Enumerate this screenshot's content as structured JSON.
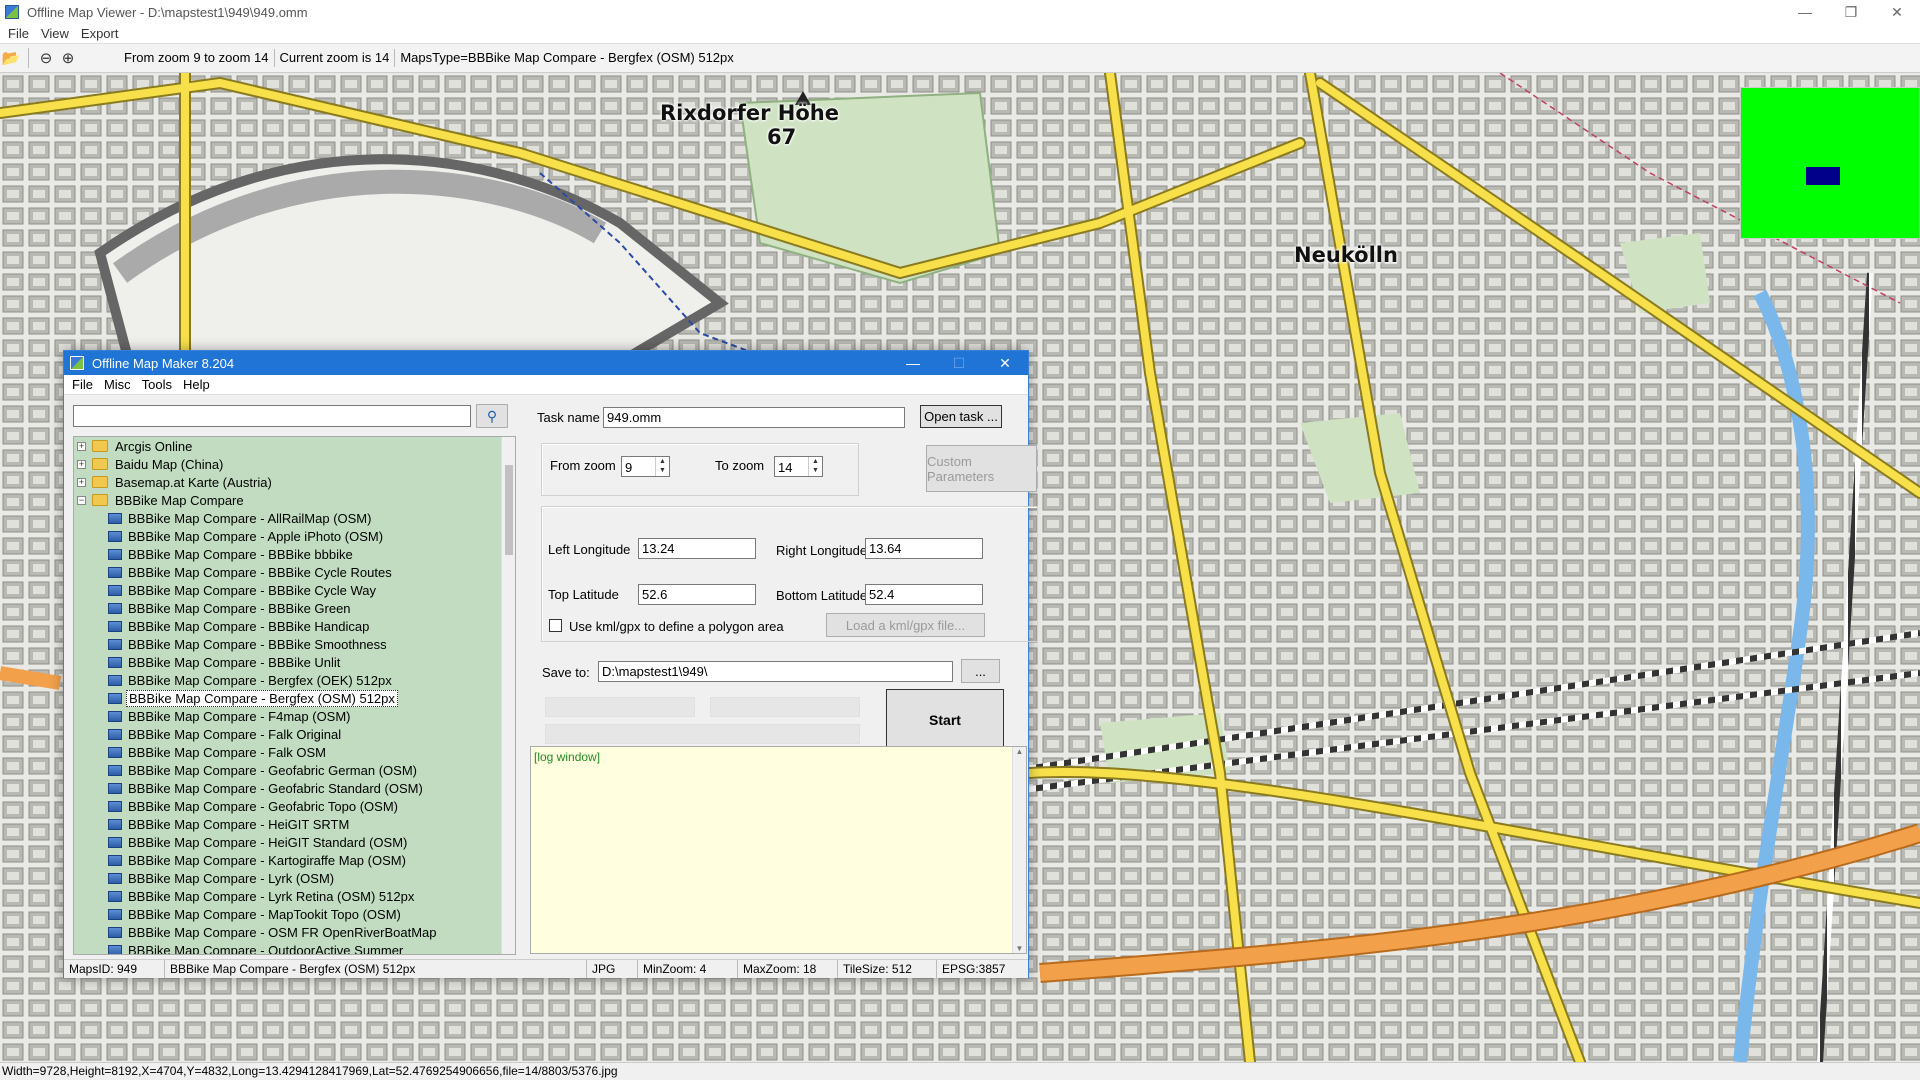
{
  "viewer": {
    "title": "Offline Map Viewer - D:\\mapstest1\\949\\949.omm",
    "menu": [
      "File",
      "View",
      "Export"
    ],
    "toolbar": {
      "zoom_range": "From zoom 9 to zoom 14",
      "current_zoom": "Current zoom is 14",
      "maps_type": "MapsType=BBBike Map Compare - Bergfex (OSM) 512px"
    },
    "map_labels": {
      "rixdorfer_hoehe": "Rixdorfer Höhe",
      "elevation": "67",
      "neukoelln": "Neukölln"
    },
    "status": "Width=9728,Height=8192,X=4704,Y=4832,Long=13.4294128417969,Lat=52.4769254906656,file=14/8803/5376.jpg"
  },
  "dialog": {
    "title": "Offline Map Maker 8.204",
    "menu": [
      "File",
      "Misc",
      "Tools",
      "Help"
    ],
    "search": {
      "value": "",
      "placeholder": ""
    },
    "tree": {
      "top_folders": [
        "Arcgis Online",
        "Baidu Map (China)",
        "Basemap.at Karte (Austria)",
        "BBBike Map Compare"
      ],
      "children": [
        "BBBike Map Compare - AllRailMap (OSM)",
        "BBBike Map Compare - Apple iPhoto (OSM)",
        "BBBike Map Compare - BBBike bbbike",
        "BBBike Map Compare - BBBike Cycle Routes",
        "BBBike Map Compare - BBBike Cycle Way",
        "BBBike Map Compare - BBBike Green",
        "BBBike Map Compare - BBBike Handicap",
        "BBBike Map Compare - BBBike Smoothness",
        "BBBike Map Compare - BBBike Unlit",
        "BBBike Map Compare - Bergfex (OEK) 512px",
        "BBBike Map Compare - Bergfex (OSM) 512px",
        "BBBike Map Compare - F4map (OSM)",
        "BBBike Map Compare - Falk Original",
        "BBBike Map Compare - Falk OSM",
        "BBBike Map Compare - Geofabric German (OSM)",
        "BBBike Map Compare - Geofabric Standard (OSM)",
        "BBBike Map Compare - Geofabric Topo (OSM)",
        "BBBike Map Compare - HeiGIT SRTM",
        "BBBike Map Compare - HeiGIT Standard (OSM)",
        "BBBike Map Compare - Kartogiraffe Map (OSM)",
        "BBBike Map Compare - Lyrk (OSM)",
        "BBBike Map Compare - Lyrk Retina (OSM) 512px",
        "BBBike Map Compare - MapTookit Topo (OSM)",
        "BBBike Map Compare - OSM FR OpenRiverBoatMap",
        "BBBike Map Compare - OutdoorActive Summer"
      ],
      "selected_index": 10
    },
    "task_name_label": "Task name",
    "task_name_value": "949.omm",
    "open_task_label": "Open task ...",
    "from_zoom_label": "From zoom",
    "from_zoom_value": "9",
    "to_zoom_label": "To zoom",
    "to_zoom_value": "14",
    "custom_params_label": "Custom Parameters",
    "left_lon_label": "Left Longitude",
    "left_lon_value": "13.24",
    "right_lon_label": "Right Longitude",
    "right_lon_value": "13.64",
    "top_lat_label": "Top Latitude",
    "top_lat_value": "52.6",
    "bottom_lat_label": "Bottom Latitude",
    "bottom_lat_value": "52.4",
    "kml_checkbox_label": "Use kml/gpx to define a polygon area",
    "load_kml_label": "Load a kml/gpx file...",
    "save_to_label": "Save to:",
    "save_to_value": "D:\\mapstest1\\949\\",
    "browse_label": "...",
    "start_label": "Start",
    "log_text": "[log window]",
    "status": {
      "maps_id": "MapsID: 949",
      "map_name": "BBBike Map Compare - Bergfex (OSM) 512px",
      "format": "JPG",
      "min_zoom": "MinZoom: 4",
      "max_zoom": "MaxZoom: 18",
      "tile_size": "TileSize: 512",
      "epsg": "EPSG:3857"
    }
  },
  "colors": {
    "dialog_titlebar": "#1f74d6",
    "tree_bg": "#c1dcc1",
    "log_bg": "#ffffe0",
    "minimap": "#00ff00",
    "minimap_viewport": "#00008b",
    "road_major": "#f7e04a"
  }
}
